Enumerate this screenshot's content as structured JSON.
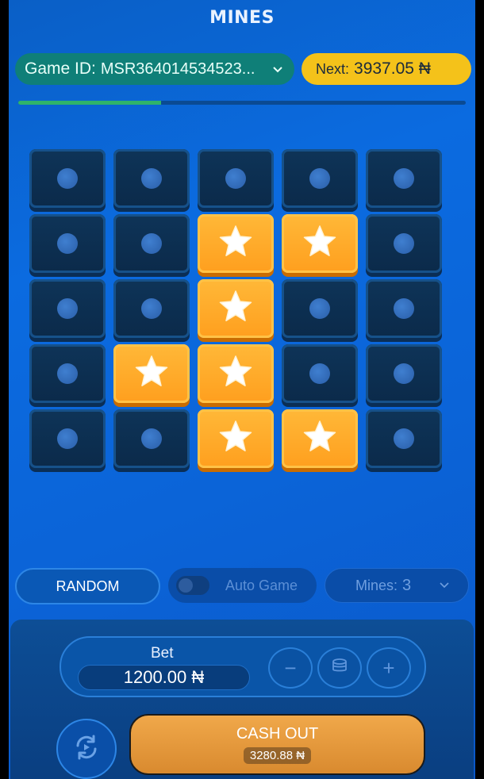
{
  "header": {
    "title": "MINES"
  },
  "game_id": {
    "label": "Game ID:",
    "value": "MSR364014534523...",
    "icon": "chevron-down-icon"
  },
  "next": {
    "label": "Next:",
    "value": "3937.05 ₦"
  },
  "progress": {
    "fraction": 0.32,
    "fill_color": "#2fb36a",
    "track_color": "#0a4a93"
  },
  "board": {
    "rows": 5,
    "cols": 5,
    "tiles": [
      [
        "closed",
        "closed",
        "closed",
        "closed",
        "closed"
      ],
      [
        "closed",
        "closed",
        "star",
        "star",
        "closed"
      ],
      [
        "closed",
        "closed",
        "star",
        "closed",
        "closed"
      ],
      [
        "closed",
        "star",
        "star",
        "closed",
        "closed"
      ],
      [
        "closed",
        "closed",
        "star",
        "star",
        "closed"
      ]
    ],
    "star_color": "#ffb838",
    "closed_color": "#0e3458"
  },
  "controls": {
    "random_label": "RANDOM",
    "auto_game_label": "Auto Game",
    "auto_game_on": false,
    "mines_label": "Mines:",
    "mines_value": "3"
  },
  "bet": {
    "label": "Bet",
    "value": "1200.00 ₦",
    "minus": "−",
    "plus": "+",
    "coins_icon": "coin-stack-icon"
  },
  "cashout": {
    "label": "CASH OUT",
    "amount": "3280.88 ₦",
    "color": "#f0a84a"
  },
  "refresh_icon": "refresh-icon"
}
